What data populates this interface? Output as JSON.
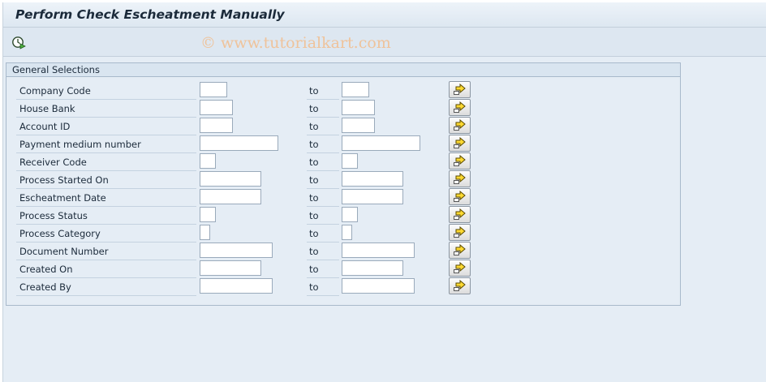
{
  "window": {
    "title": "Perform Check Escheatment Manually"
  },
  "toolbar": {
    "execute_icon": "execute-clock-icon"
  },
  "watermark": "© www.tutorialkart.com",
  "general_selections": {
    "title": "General Selections",
    "to_label": "to",
    "multiple_selection_icon": "multiple-selection-arrow-icon",
    "rows": [
      {
        "label": "Company Code",
        "from": "",
        "to": ""
      },
      {
        "label": "House Bank",
        "from": "",
        "to": ""
      },
      {
        "label": "Account ID",
        "from": "",
        "to": ""
      },
      {
        "label": "Payment medium number",
        "from": "",
        "to": ""
      },
      {
        "label": "Receiver Code",
        "from": "",
        "to": ""
      },
      {
        "label": "Process Started On",
        "from": "",
        "to": ""
      },
      {
        "label": "Escheatment Date",
        "from": "",
        "to": ""
      },
      {
        "label": "Process Status",
        "from": "",
        "to": ""
      },
      {
        "label": "Process Category",
        "from": "",
        "to": ""
      },
      {
        "label": "Document Number",
        "from": "",
        "to": ""
      },
      {
        "label": "Created On",
        "from": "",
        "to": ""
      },
      {
        "label": "Created By",
        "from": "",
        "to": ""
      }
    ]
  }
}
